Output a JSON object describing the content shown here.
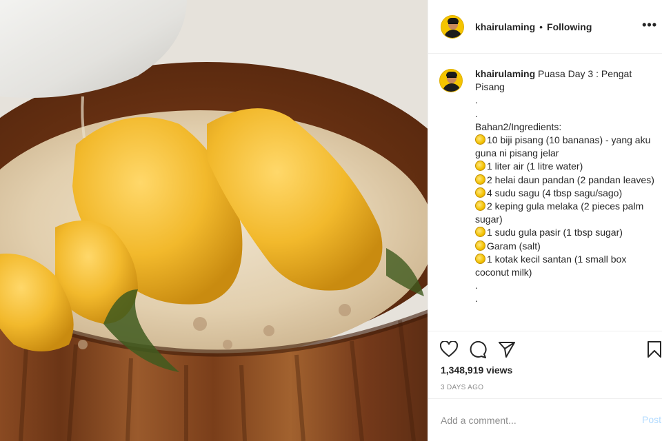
{
  "post": {
    "username": "khairulaming",
    "separator": "•",
    "follow_status": "Following",
    "more_label": "•••"
  },
  "caption": {
    "username": "khairulaming",
    "title": "Puasa Day 3 : Pengat Pisang",
    "lines": [
      ".",
      ".",
      "Bahan2/Ingredients:",
      "10 biji pisang (10 bananas) - yang aku guna ni pisang jelar",
      "1 liter air (1 litre water)",
      "2 helai daun pandan (2 pandan leaves)",
      "4 sudu sagu (4 tbsp sagu/sago)",
      "2 keping gula melaka (2 pieces palm sugar)",
      "1 sudu gula pasir (1 tbsp sugar)",
      "Garam (salt)",
      "1 kotak kecil santan (1 small box coconut milk)",
      ".",
      "."
    ],
    "bullet_icon": "sun-emoji-icon"
  },
  "stats": {
    "views": "1,348,919 views",
    "posted": "3 DAYS AGO"
  },
  "comment": {
    "placeholder": "Add a comment...",
    "post_label": "Post"
  },
  "icons": {
    "like": "heart-icon",
    "comment": "comment-bubble-icon",
    "share": "paper-plane-icon",
    "save": "bookmark-icon"
  }
}
